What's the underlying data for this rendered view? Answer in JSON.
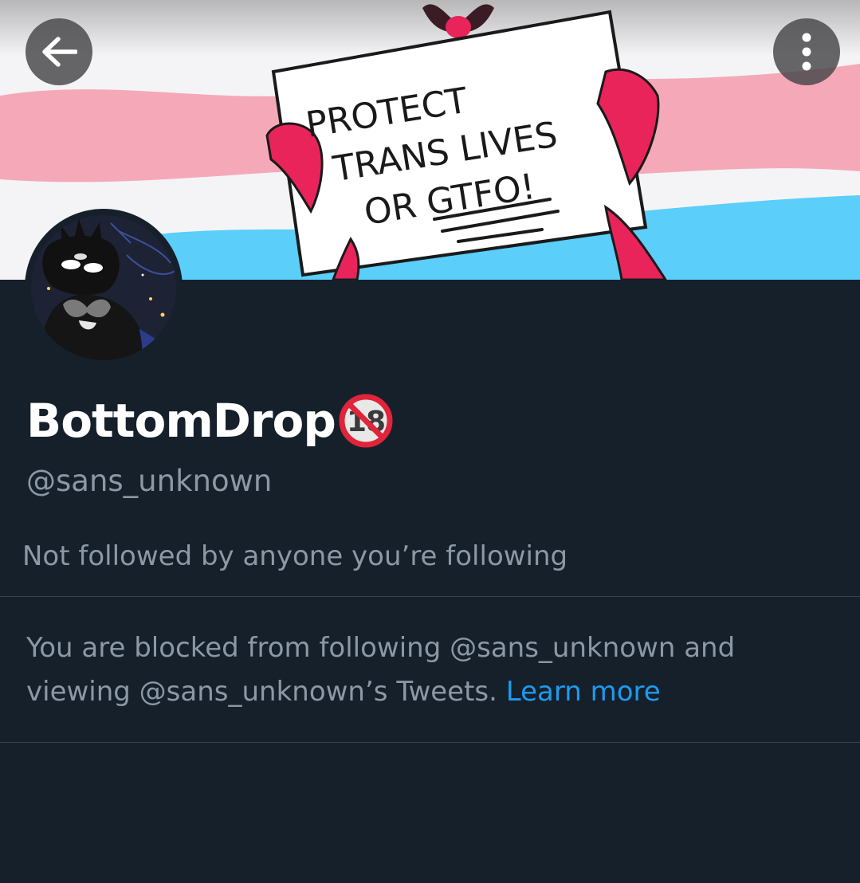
{
  "header": {
    "back_icon": "arrow-left-icon",
    "more_icon": "more-vertical-icon",
    "banner": {
      "sign_lines": [
        "PROTECT",
        "TRANS LIVES",
        "OR GTFO!"
      ],
      "colors": {
        "pink": "#f5a9b8",
        "blue": "#5bcefa",
        "white": "#f4f4f6",
        "claw": "#e8245a"
      }
    }
  },
  "profile": {
    "display_name": "BottomDrop",
    "badge_text": "18",
    "handle": "@sans_unknown",
    "followers_you_know": "Not followed by anyone you’re following"
  },
  "blocked_notice": {
    "text": "You are blocked from following @sans_unknown and viewing @sans_unknown’s Tweets. ",
    "link": "Learn more"
  },
  "colors": {
    "background": "#15202b",
    "primary_text": "#ffffff",
    "secondary_text": "#8b98a5",
    "link": "#1d9bf0",
    "divider": "#38444d"
  }
}
